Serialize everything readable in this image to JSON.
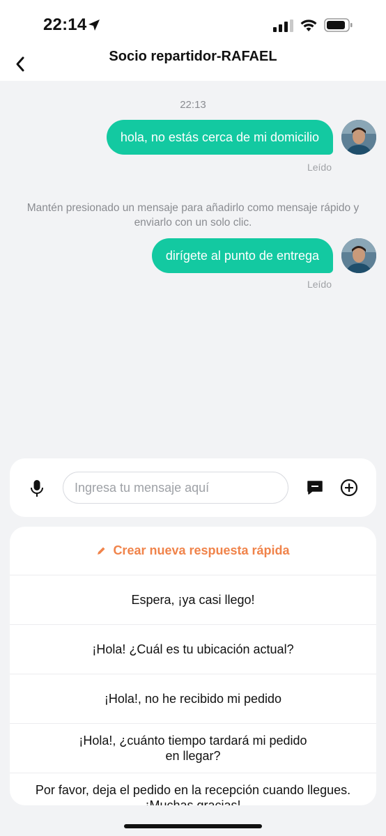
{
  "status_bar": {
    "time": "22:14",
    "icons": [
      "location-arrow-icon",
      "cellular-signal-icon",
      "wifi-icon",
      "battery-icon"
    ]
  },
  "header": {
    "back_icon": "chevron-left-icon",
    "title": "Socio repartidor-RAFAEL"
  },
  "chat": {
    "timestamp": "22:13",
    "messages": [
      {
        "text": "hola, no estás cerca de mi domicilio",
        "status": "Leído"
      },
      {
        "text": "dirígete al punto de entrega",
        "status": "Leído"
      }
    ],
    "hint": "Mantén presionado un mensaje para añadirlo como mensaje rápido y enviarlo con un solo clic."
  },
  "input_bar": {
    "placeholder": "Ingresa tu mensaje aquí",
    "value": "",
    "icons": [
      "microphone-icon",
      "quick-reply-icon",
      "plus-circle-icon"
    ]
  },
  "quick_replies": {
    "create_label": "Crear nueva respuesta rápida",
    "items": [
      "Espera, ¡ya casi llego!",
      "¡Hola! ¿Cuál es tu ubicación actual?",
      "¡Hola!, no he recibido mi pedido",
      "¡Hola!, ¿cuánto tiempo tardará mi pedido en llegar?",
      "Por favor, deja el pedido en la recepción cuando llegues. ¡Muchas gracias!"
    ]
  },
  "colors": {
    "accent": "#13c9a1",
    "create_orange": "#f0834a",
    "background": "#f2f3f5"
  }
}
